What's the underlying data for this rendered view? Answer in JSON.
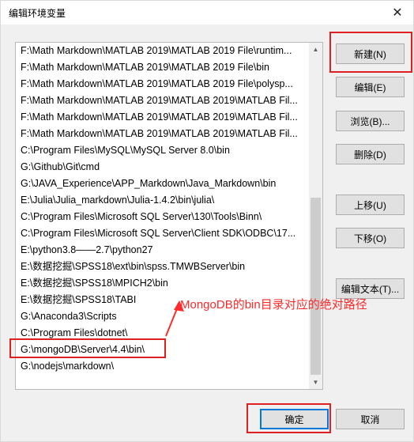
{
  "window": {
    "title": "编辑环境变量",
    "close_glyph": "✕"
  },
  "list": {
    "items": [
      "F:\\Math Markdown\\MATLAB 2019\\MATLAB 2019 File\\runtim...",
      "F:\\Math Markdown\\MATLAB 2019\\MATLAB 2019 File\\bin",
      "F:\\Math Markdown\\MATLAB 2019\\MATLAB 2019 File\\polysp...",
      "F:\\Math Markdown\\MATLAB 2019\\MATLAB 2019\\MATLAB Fil...",
      "F:\\Math Markdown\\MATLAB 2019\\MATLAB 2019\\MATLAB Fil...",
      "F:\\Math Markdown\\MATLAB 2019\\MATLAB 2019\\MATLAB Fil...",
      "C:\\Program Files\\MySQL\\MySQL Server 8.0\\bin",
      "G:\\Github\\Git\\cmd",
      "G:\\JAVA_Experience\\APP_Markdown\\Java_Markdown\\bin",
      "E:\\Julia\\Julia_markdown\\Julia-1.4.2\\bin\\julia\\",
      "C:\\Program Files\\Microsoft SQL Server\\130\\Tools\\Binn\\",
      "C:\\Program Files\\Microsoft SQL Server\\Client SDK\\ODBC\\17...",
      "E:\\python3.8——2.7\\python27",
      "E:\\数据挖掘\\SPSS18\\ext\\bin\\spss.TMWBServer\\bin",
      "E:\\数据挖掘\\SPSS18\\MPICH2\\bin",
      "E:\\数据挖掘\\SPSS18\\TABI",
      "G:\\Anaconda3\\Scripts",
      "C:\\Program Files\\dotnet\\",
      "G:\\mongoDB\\Server\\4.4\\bin\\",
      "G:\\nodejs\\markdown\\"
    ]
  },
  "buttons": {
    "new": "新建(N)",
    "edit": "编辑(E)",
    "browse": "浏览(B)...",
    "delete": "删除(D)",
    "move_up": "上移(U)",
    "move_down": "下移(O)",
    "edit_text": "编辑文本(T)...",
    "ok": "确定",
    "cancel": "取消"
  },
  "annotation": {
    "text": "MongoDB的bin目录对应的绝对路径",
    "color": "#ff2a2a"
  },
  "colors": {
    "highlight": "#e02020",
    "accent": "#0078d7"
  }
}
